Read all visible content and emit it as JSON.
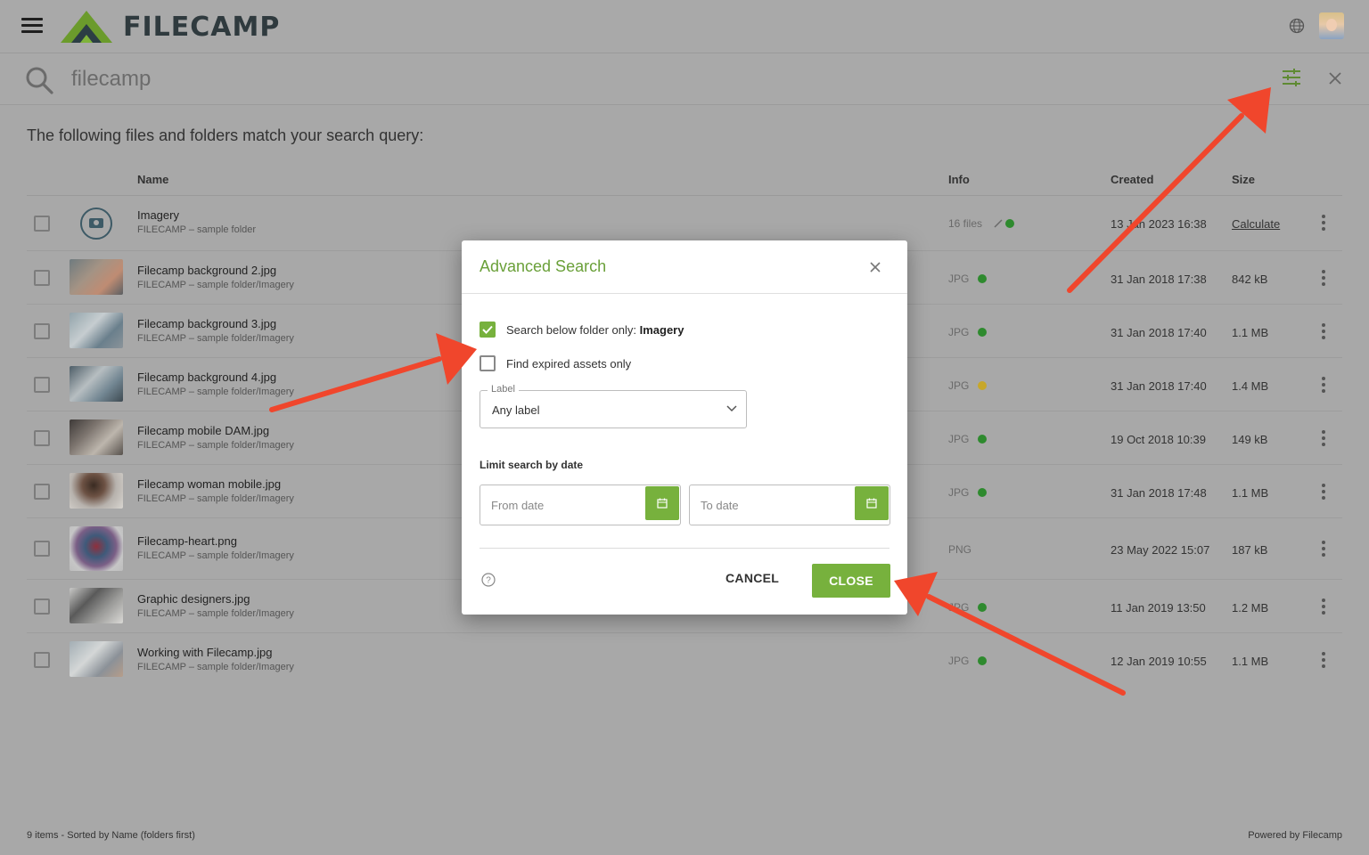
{
  "app": {
    "logo_text": "FILECAMP",
    "brand_color": "#77b13d",
    "accent_text_color": "#6aa039"
  },
  "search": {
    "value": "filecamp",
    "placeholder": ""
  },
  "intro_text": "The following files and folders match your search query:",
  "table": {
    "columns": {
      "name": "Name",
      "info": "Info",
      "created": "Created",
      "size": "Size"
    },
    "rows": [
      {
        "name": "Imagery",
        "path": "FILECAMP – sample folder",
        "info": "16 files",
        "status": "green",
        "created": "13 Jan 2023 16:38",
        "size": "Calculate"
      },
      {
        "name": "Filecamp background 2.jpg",
        "path": "FILECAMP – sample folder/Imagery",
        "info": "JPG",
        "status": "green",
        "created": "31 Jan 2018 17:38",
        "size": "842 kB"
      },
      {
        "name": "Filecamp background 3.jpg",
        "path": "FILECAMP – sample folder/Imagery",
        "info": "JPG",
        "status": "green",
        "created": "31 Jan 2018 17:40",
        "size": "1.1 MB"
      },
      {
        "name": "Filecamp background 4.jpg",
        "path": "FILECAMP – sample folder/Imagery",
        "info": "JPG",
        "status": "yellow",
        "created": "31 Jan 2018 17:40",
        "size": "1.4 MB"
      },
      {
        "name": "Filecamp mobile DAM.jpg",
        "path": "FILECAMP – sample folder/Imagery",
        "info": "JPG",
        "status": "green",
        "created": "19 Oct 2018 10:39",
        "size": "149 kB"
      },
      {
        "name": "Filecamp woman mobile.jpg",
        "path": "FILECAMP – sample folder/Imagery",
        "info": "JPG",
        "status": "green",
        "created": "31 Jan 2018 17:48",
        "size": "1.1 MB"
      },
      {
        "name": "Filecamp-heart.png",
        "path": "FILECAMP – sample folder/Imagery",
        "info": "PNG",
        "status": "none",
        "created": "23 May 2022 15:07",
        "size": "187 kB"
      },
      {
        "name": "Graphic designers.jpg",
        "path": "FILECAMP – sample folder/Imagery",
        "info": "JPG",
        "status": "green",
        "created": "11 Jan 2019 13:50",
        "size": "1.2 MB"
      },
      {
        "name": "Working with Filecamp.jpg",
        "path": "FILECAMP – sample folder/Imagery",
        "info": "JPG",
        "status": "green",
        "created": "12 Jan 2019 10:55",
        "size": "1.1 MB"
      }
    ]
  },
  "footer": {
    "left": "9 items - Sorted by Name (folders first)",
    "right": "Powered by Filecamp"
  },
  "modal": {
    "title": "Advanced Search",
    "search_below_label": "Search below folder only:",
    "search_below_folder": "Imagery",
    "search_below_checked": true,
    "expired_label": "Find expired assets only",
    "expired_checked": false,
    "label_field_legend": "Label",
    "label_field_value": "Any label",
    "date_heading": "Limit search by date",
    "from_placeholder": "From date",
    "to_placeholder": "To date",
    "cancel_label": "CANCEL",
    "close_label": "CLOSE"
  },
  "icons": {
    "menu": "hamburger-icon",
    "globe": "globe-icon",
    "search": "search-icon",
    "filter": "sliders-icon",
    "close": "close-icon",
    "calendar": "calendar-icon",
    "help": "question-circle-icon",
    "more": "kebab-icon"
  },
  "status_colors": {
    "green": "#2e8a2e",
    "yellow": "#c7a72a"
  },
  "annotation_color": "#f0462c"
}
